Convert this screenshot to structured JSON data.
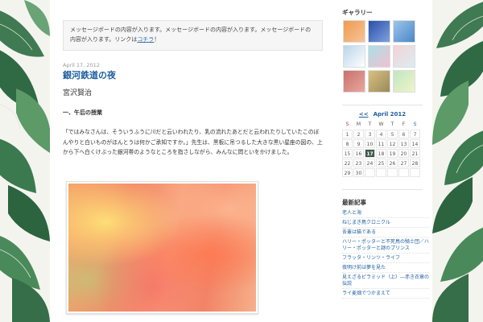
{
  "message_board": {
    "text": "メッセージボードの内容が入ります。メッセージボードの内容が入ります。メッセージボードの内容が入ります。リンクは",
    "link": "コチラ",
    "suffix": "！"
  },
  "post": {
    "date": "April 17, 2012",
    "title": "銀河鉄道の夜",
    "author": "宮沢賢治",
    "section": "一、午后の授業",
    "body": "「ではみなさんは、そういうふうに川だと云いわれたり、乳の流れたあとだと云われたりしていたこのぼんやりと白いものがほんとうは何かご承知ですか。」先生は、黒板に吊つるした大きな黒い星座の図の、上から下へ白くけぶった銀河帯のようなところを指さしながら、みんなに問といをかけました。"
  },
  "gallery": {
    "heading": "ギャラリー",
    "thumbs": [
      {
        "colors": [
          "#f09a4e",
          "#f7c39a"
        ]
      },
      {
        "colors": [
          "#2a4fa8",
          "#7fa2e0"
        ]
      },
      {
        "colors": [
          "#9cc6ea",
          "#4a86c8"
        ]
      },
      {
        "colors": [
          "#b9d4e8",
          "#ffffff"
        ]
      },
      {
        "colors": [
          "#a8e0e6",
          "#f4c0d0"
        ]
      },
      {
        "colors": [
          "#f2d2d8",
          "#dceef0"
        ]
      },
      {
        "colors": [
          "#c8706a",
          "#e8a8a0"
        ]
      },
      {
        "colors": [
          "#d8c080",
          "#9a8a5a"
        ]
      },
      {
        "colors": [
          "#bfe6c4",
          "#f0f4c8"
        ]
      }
    ]
  },
  "calendar": {
    "prev": "<<",
    "month": "April 2012",
    "weekdays": [
      "S",
      "M",
      "T",
      "W",
      "T",
      "F",
      "S"
    ],
    "today": "17",
    "weeks": [
      [
        "1",
        "2",
        "3",
        "4",
        "5",
        "6",
        "7"
      ],
      [
        "8",
        "9",
        "10",
        "11",
        "12",
        "13",
        "14"
      ],
      [
        "15",
        "16",
        "17",
        "18",
        "19",
        "20",
        "21"
      ],
      [
        "22",
        "23",
        "24",
        "25",
        "26",
        "27",
        "28"
      ],
      [
        "29",
        "30",
        "",
        "",
        "",
        "",
        ""
      ]
    ]
  },
  "recent": {
    "heading": "最新記事",
    "items": [
      "老人と海",
      "ねじまき鳥クロニクル",
      "吾輩は猫である",
      "ハリー・ポッターと不死鳥の騎士団／ハリー・ポッターと謎のプリンス",
      "フラッタ・リンツ・ライフ",
      "夜明け前は夢を見た",
      "見えざるピラミッド（上）―赤き衣章の伝説",
      "ライ麦畑でつかまえて"
    ]
  }
}
